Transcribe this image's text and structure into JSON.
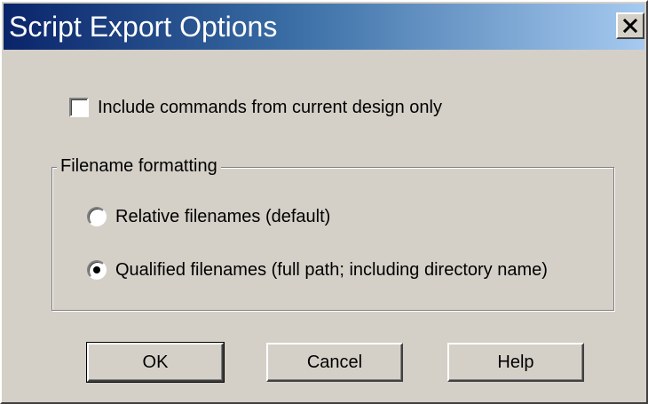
{
  "window": {
    "title": "Script Export Options",
    "close_glyph": "✕",
    "close_icon": "close-icon",
    "titlebar_colors": [
      "#0a246a",
      "#3a6ea5",
      "#a6caf0"
    ]
  },
  "options": {
    "include_current_only": {
      "label": "Include commands from current design only",
      "checked": false
    }
  },
  "filename_formatting": {
    "legend": "Filename formatting",
    "choices": [
      {
        "label": "Relative filenames (default)",
        "selected": false
      },
      {
        "label": "Qualified filenames (full path; including directory name)",
        "selected": true
      }
    ]
  },
  "buttons": {
    "ok": "OK",
    "cancel": "Cancel",
    "help": "Help"
  }
}
